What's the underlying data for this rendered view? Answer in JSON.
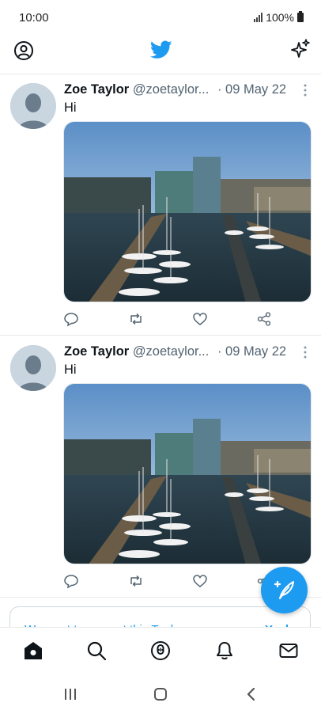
{
  "status_bar": {
    "time": "10:00",
    "battery": "100%"
  },
  "topbar": {
    "profile_icon": "profile-icon",
    "logo_icon": "twitter-bird-icon",
    "sparkle_icon": "sparkle-icon"
  },
  "tweets": [
    {
      "name": "Zoe Taylor",
      "handle": "@zoetaylor...",
      "date": "09 May 22",
      "text": "Hi",
      "media": "marina-photo"
    },
    {
      "name": "Zoe Taylor",
      "handle": "@zoetaylor...",
      "date": "09 May 22",
      "text": "Hi",
      "media": "marina-photo"
    }
  ],
  "tweet_actions": [
    "reply-icon",
    "retweet-icon",
    "like-icon",
    "share-icon"
  ],
  "promo": {
    "text": "We want to support this Tuck ...",
    "link": "Yeah"
  },
  "fab": {
    "icon": "compose-icon"
  },
  "bottom_nav": [
    "home-icon",
    "search-icon",
    "spaces-icon",
    "notifications-icon",
    "messages-icon"
  ],
  "system_nav": [
    "recents-button",
    "home-button",
    "back-button"
  ],
  "colors": {
    "accent": "#1d9bf0",
    "text": "#0f1419",
    "muted": "#536471",
    "divider": "#e7e9ea"
  }
}
